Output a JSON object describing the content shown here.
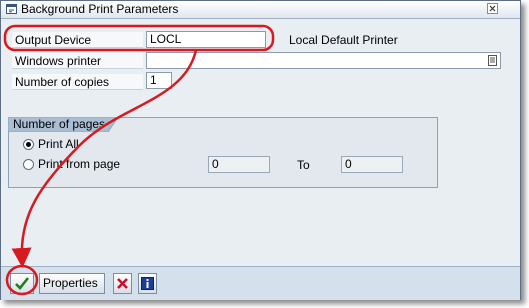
{
  "window": {
    "title": "Background Print Parameters"
  },
  "form": {
    "output_device": {
      "label": "Output Device",
      "value": "LOCL",
      "description": "Local Default Printer"
    },
    "windows_printer": {
      "label": "Windows printer",
      "value": ""
    },
    "copies": {
      "label": "Number of copies",
      "value": "1"
    }
  },
  "pages_group": {
    "title": "Number of pages",
    "print_all_label": "Print All",
    "print_from_label": "Print from page",
    "from_value": "0",
    "to_label": "To",
    "to_value": "0",
    "selected": "Print All"
  },
  "toolbar": {
    "properties_label": "Properties"
  },
  "icons": {
    "title": "print-parameters-icon",
    "close": "close-icon",
    "f4": "value-help-icon",
    "continue": "checkmark-icon",
    "cancel": "cancel-x-icon",
    "info": "info-icon"
  },
  "colors": {
    "annotation": "#d71920",
    "continue_check": "#1e7d1e",
    "cancel_x": "#c8102e",
    "info_bg": "#1c3f94"
  }
}
